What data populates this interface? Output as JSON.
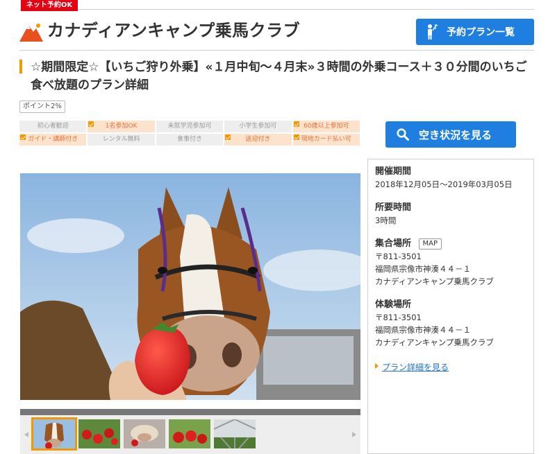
{
  "badge": {
    "net_booking": "ネット予約OK"
  },
  "header": {
    "site_title": "カナディアンキャンプ乗馬クラブ",
    "plan_list_button": "予約プラン一覧"
  },
  "plan": {
    "title": "☆期間限定☆【いちご狩り外乗】«１月中旬～４月末»３時間の外乗コース＋３０分間のいちご食べ放題のプラン詳細",
    "point_tag": "ポイント2%"
  },
  "features": [
    {
      "label": "初心者歓迎",
      "active": false
    },
    {
      "label": "1名参加OK",
      "active": true
    },
    {
      "label": "未就学児参加可",
      "active": false
    },
    {
      "label": "小学生参加可",
      "active": false
    },
    {
      "label": "60歳以上参加可",
      "active": true
    },
    {
      "label": "ガイド・講師付き",
      "active": true
    },
    {
      "label": "レンタル無料",
      "active": false
    },
    {
      "label": "食事付き",
      "active": false
    },
    {
      "label": "送迎付き",
      "active": true
    },
    {
      "label": "現地カード払い可",
      "active": true
    }
  ],
  "vacancy_button": "空き状況を見る",
  "info": {
    "period_heading": "開催期間",
    "period_value": "2018年12月05日～2019年03月05日",
    "duration_heading": "所要時間",
    "duration_value": "3時間",
    "meeting_heading": "集合場所",
    "map_button": "MAP",
    "meeting_zip": "〒811-3501",
    "meeting_address": "福岡県宗像市神湊４４－１",
    "meeting_name": "カナディアンキャンプ乗馬クラブ",
    "venue_heading": "体験場所",
    "venue_zip": "〒811-3501",
    "venue_address": "福岡県宗像市神湊４４－１",
    "venue_name": "カナディアンキャンプ乗馬クラブ",
    "detail_link": "プラン詳細を見る"
  },
  "colors": {
    "accent_blue": "#1f7fe0",
    "accent_orange": "#f39800",
    "badge_red": "#e60012",
    "feature_on_bg": "#fde3cc",
    "feature_off_bg": "#eeeeee"
  },
  "icons": [
    "mountain-logo-icon",
    "person-flag-icon",
    "search-icon",
    "chevron-left-icon",
    "chevron-right-icon"
  ]
}
